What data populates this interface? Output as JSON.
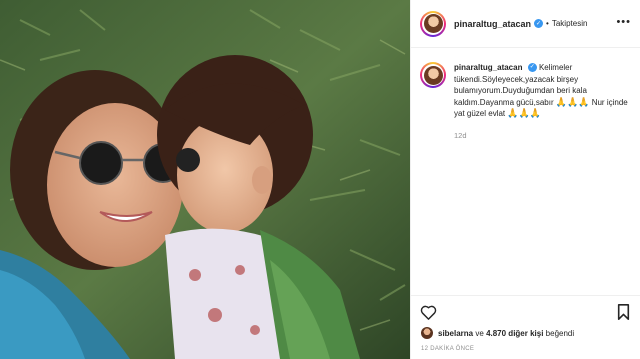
{
  "header": {
    "username": "pinaraltug_atacan",
    "separator": "•",
    "follow_status": "Takiptesin",
    "more_icon": "more-horizontal-icon"
  },
  "caption": {
    "username": "pinaraltug_atacan",
    "text": "Kelimeler tükendi.Söyleyecek,yazacak birşey bulamıyorum.Duyduğumdan beri kala kaldım.Dayanma gücü,sabır",
    "emoji_1": "🙏🙏🙏",
    "text_2": "Nur içinde yat güzel evlat",
    "emoji_2": "🙏🙏🙏",
    "time": "12d"
  },
  "actions": {
    "like_icon": "heart-icon",
    "save_icon": "bookmark-icon"
  },
  "likes": {
    "user": "sibelarna",
    "connector": "ve",
    "count_text": "4.870 diğer kişi",
    "suffix": "beğendi"
  },
  "post_time": "12 DAKİKA ÖNCE",
  "colors": {
    "verified": "#3897f0",
    "muted_text": "#8e8e8e",
    "border": "#efefef"
  }
}
